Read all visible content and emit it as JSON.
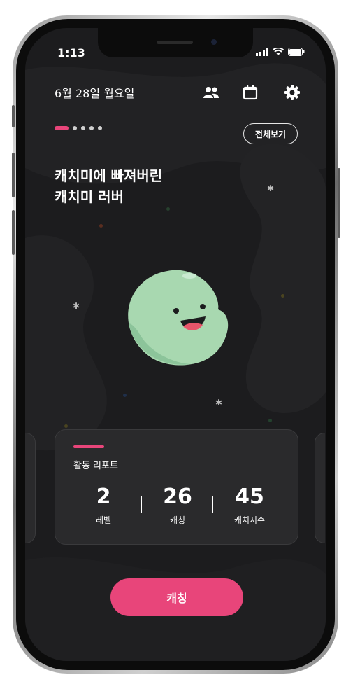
{
  "status_bar": {
    "time": "1:13"
  },
  "header": {
    "date": "6월 28일 월요일"
  },
  "pager": {
    "count": 5,
    "active_index": 0
  },
  "view_all_label": "전체보기",
  "headline": {
    "line1": "캐치미에 빠져버린",
    "line2": "캐치미 러버"
  },
  "report": {
    "title": "활동 리포트",
    "stats": [
      {
        "value": "2",
        "label": "레벨"
      },
      {
        "value": "26",
        "label": "캐칭"
      },
      {
        "value": "45",
        "label": "캐치지수"
      }
    ]
  },
  "catch_button_label": "캐칭",
  "colors": {
    "accent": "#e8457a",
    "background": "#1c1c1e",
    "card": "#2a2a2c",
    "character": "#a8d8b0"
  },
  "icons": [
    "friends-icon",
    "calendar-icon",
    "settings-icon",
    "signal-icon",
    "wifi-icon",
    "battery-icon"
  ]
}
